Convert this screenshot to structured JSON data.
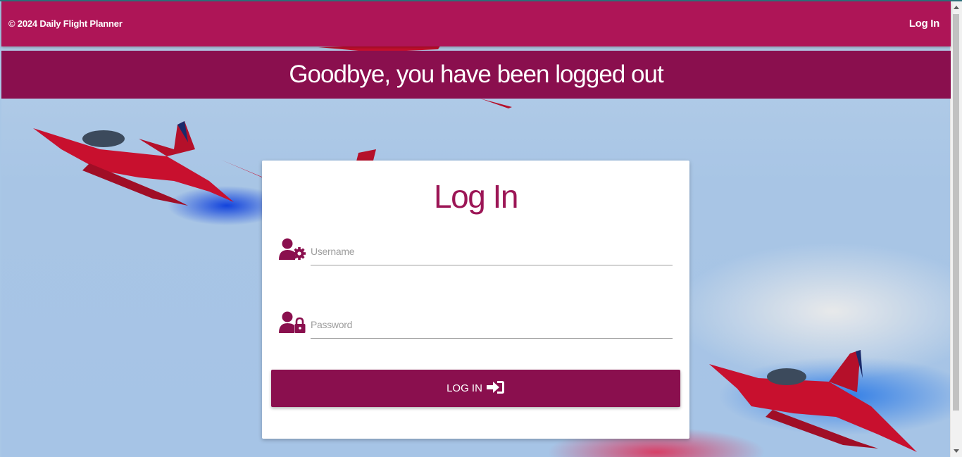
{
  "navbar": {
    "brand": "© 2024 Daily Flight Planner",
    "login_link": "Log In"
  },
  "banner": {
    "message": "Goodbye, you have been logged out"
  },
  "login_card": {
    "title": "Log In",
    "username": {
      "placeholder": "Username",
      "value": "",
      "icon": "user-gear-icon"
    },
    "password": {
      "placeholder": "Password",
      "value": "",
      "icon": "user-lock-icon"
    },
    "submit_label": "LOG IN",
    "submit_icon": "sign-in-icon"
  },
  "colors": {
    "navbar": "#ae1557",
    "banner": "#8a0f4e",
    "accent": "#9c1656",
    "button": "#8a0f4e"
  }
}
